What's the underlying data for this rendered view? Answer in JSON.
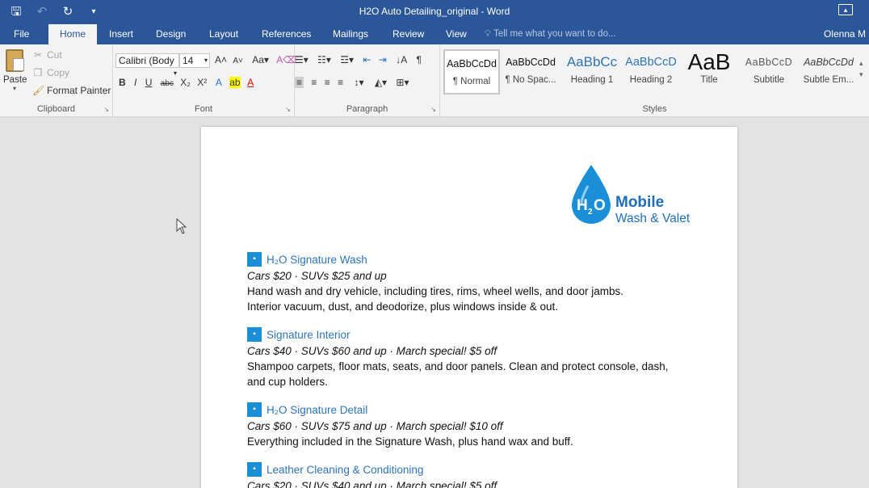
{
  "window": {
    "title": "H2O Auto Detailing_original - Word"
  },
  "tabs": [
    {
      "label": "File",
      "active": false
    },
    {
      "label": "Home",
      "active": true
    },
    {
      "label": "Insert",
      "active": false
    },
    {
      "label": "Design",
      "active": false
    },
    {
      "label": "Layout",
      "active": false
    },
    {
      "label": "References",
      "active": false
    },
    {
      "label": "Mailings",
      "active": false
    },
    {
      "label": "Review",
      "active": false
    },
    {
      "label": "View",
      "active": false
    }
  ],
  "tell_me": "Tell me what you want to do...",
  "user": "Olenna M",
  "clipboard": {
    "paste": "Paste",
    "cut": "Cut",
    "copy": "Copy",
    "format_painter": "Format Painter",
    "label": "Clipboard"
  },
  "font": {
    "name": "Calibri (Body",
    "size": "14",
    "label": "Font"
  },
  "paragraph": {
    "label": "Paragraph"
  },
  "styles": {
    "label": "Styles",
    "items": [
      {
        "sample": "AaBbCcDd",
        "name": "¶ Normal",
        "selected": true
      },
      {
        "sample": "AaBbCcDd",
        "name": "¶ No Spac...",
        "selected": false
      },
      {
        "sample": "AaBbCc",
        "name": "Heading 1",
        "selected": false
      },
      {
        "sample": "AaBbCcD",
        "name": "Heading 2",
        "selected": false
      },
      {
        "sample": "AaB",
        "name": "Title",
        "selected": false
      },
      {
        "sample": "AaBbCcD",
        "name": "Subtitle",
        "selected": false
      },
      {
        "sample": "AaBbCcDd",
        "name": "Subtle Em...",
        "selected": false
      }
    ]
  },
  "document": {
    "logo": {
      "line1": "Mobile",
      "line2": "Wash & Valet"
    },
    "services": [
      {
        "name": "H₂O Signature Wash",
        "price": "Cars $20 · SUVs $25 and up",
        "desc": [
          "Hand wash and dry vehicle, including tires, rims, wheel wells, and door jambs.",
          "Interior vacuum, dust, and deodorize, plus windows inside & out."
        ]
      },
      {
        "name": "Signature Interior",
        "price": "Cars $40 · SUVs $60 and up · March special! $5 off",
        "desc": [
          "Shampoo carpets, floor mats, seats, and door panels. Clean and protect console, dash,",
          "and cup holders."
        ]
      },
      {
        "name": "H₂O Signature Detail",
        "price": "Cars $60 · SUVs $75 and up · March special! $10 off",
        "desc": [
          "Everything included in the Signature Wash, plus hand wax and buff."
        ]
      },
      {
        "name": "Leather Cleaning & Conditioning",
        "price": "Cars $20 · SUVs $40 and up · March special! $5 off",
        "desc": []
      }
    ]
  }
}
